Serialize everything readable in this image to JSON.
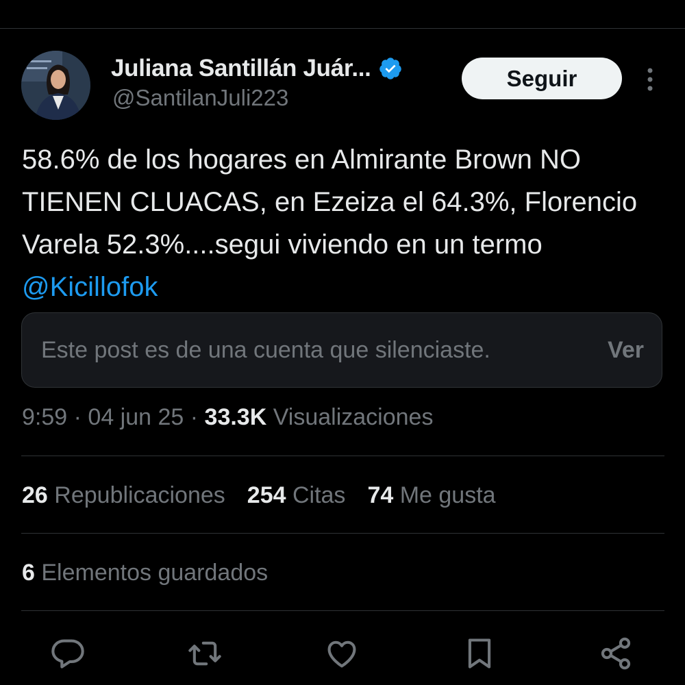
{
  "author": {
    "display_name": "Juliana Santillán Juár...",
    "handle": "@SantilanJuli223",
    "verified": true,
    "verified_color": "#1d9bf0"
  },
  "follow_button": {
    "label": "Seguir"
  },
  "tweet": {
    "text": "58.6% de los hogares en Almirante Brown NO TIENEN CLUACAS, en Ezeiza el 64.3%, Florencio Varela 52.3%....segui viviendo en un termo ",
    "mention": "@Kicillofok"
  },
  "muted_quote": {
    "message": "Este post es de una cuenta que silenciaste.",
    "view_label": "Ver"
  },
  "meta": {
    "time": "9:59",
    "separator": " · ",
    "date": "04 jun 25",
    "views_count": "33.3K",
    "views_label": "Visualizaciones"
  },
  "stats": {
    "reposts_count": "26",
    "reposts_label": "Republicaciones",
    "quotes_count": "254",
    "quotes_label": "Citas",
    "likes_count": "74",
    "likes_label": "Me gusta",
    "bookmarks_count": "6",
    "bookmarks_label": "Elementos guardados"
  },
  "actions": [
    {
      "icon": "reply-icon"
    },
    {
      "icon": "repost-icon"
    },
    {
      "icon": "like-icon"
    },
    {
      "icon": "bookmark-icon"
    },
    {
      "icon": "share-icon"
    }
  ],
  "colors": {
    "background": "#000000",
    "text_primary": "#e7e9ea",
    "text_secondary": "#71767b",
    "accent": "#1d9bf0",
    "divider": "#2f3336"
  }
}
